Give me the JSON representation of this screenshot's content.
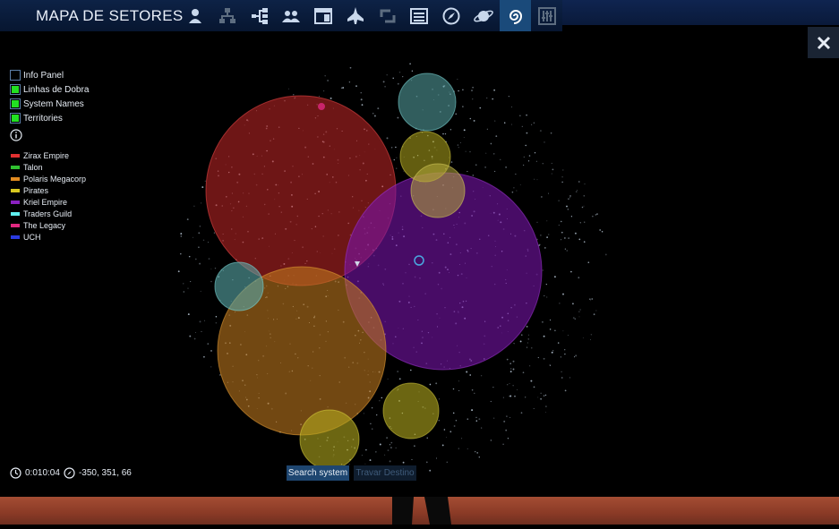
{
  "header": {
    "title": "MAPA DE SETORES",
    "icons": [
      "person-icon",
      "org-chart-icon",
      "tree-icon",
      "group-icon",
      "window-icon",
      "ship-icon",
      "cycle-icon",
      "list-icon",
      "compass-icon",
      "planet-icon",
      "galaxy-icon",
      "sliders-icon"
    ],
    "active_icon": "galaxy-icon"
  },
  "toggles": [
    {
      "label": "Info Panel",
      "checked": false
    },
    {
      "label": "Linhas de Dobra",
      "checked": true
    },
    {
      "label": "System Names",
      "checked": true
    },
    {
      "label": "Territories",
      "checked": true
    }
  ],
  "factions": [
    {
      "name": "Zirax Empire",
      "color": "#e03030"
    },
    {
      "name": "Talon",
      "color": "#30c030"
    },
    {
      "name": "Polaris Megacorp",
      "color": "#e08a20"
    },
    {
      "name": "Pirates",
      "color": "#d8c820"
    },
    {
      "name": "Kriel Empire",
      "color": "#8a20c0"
    },
    {
      "name": "Traders Guild",
      "color": "#60f0f0"
    },
    {
      "name": "The Legacy",
      "color": "#e02880"
    },
    {
      "name": "UCH",
      "color": "#2a3ae0"
    }
  ],
  "status": {
    "time": "0:010:04",
    "coordinates": "-350, 351, 66"
  },
  "buttons": {
    "search": "Search system",
    "travar": "Travar Destino"
  }
}
